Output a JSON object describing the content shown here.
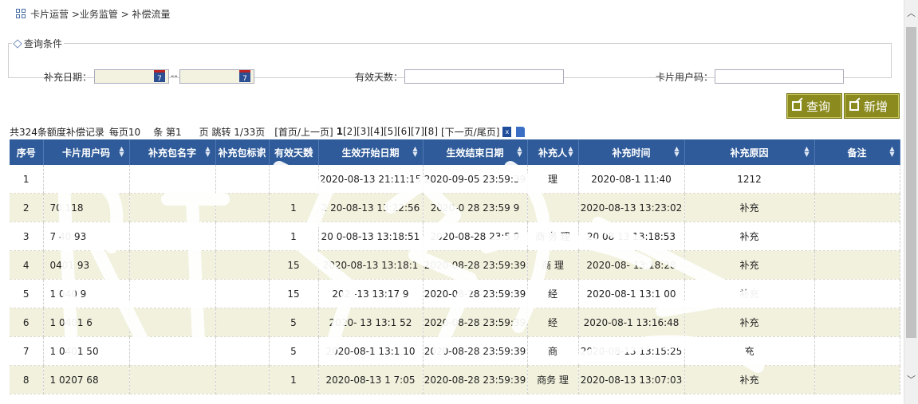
{
  "breadcrumb": {
    "text": "卡片运营 >业务监管 > 补偿流量"
  },
  "query": {
    "legend": "查询条件",
    "date_label": "补充日期：",
    "date_separator": "--",
    "cal_day": "7",
    "valid_days_label": "有效天数：",
    "card_user_label": "卡片用户码：",
    "date_from_value": "",
    "date_to_value": "",
    "valid_days_value": "",
    "card_user_value": ""
  },
  "buttons": {
    "query_label": "查询",
    "add_label": "新增"
  },
  "pager": {
    "summary": "共324条额度补偿记录",
    "per_page": "每页10",
    "tiao": "条 第1",
    "jump": "页 跳转 1/33页",
    "first_prev": "[首页/上一页]",
    "pages": [
      "1",
      "[2]",
      "[3]",
      "[4]",
      "[5]",
      "[6]",
      "[7]",
      "[8]"
    ],
    "next_last": "[下一页/尾页]",
    "excel_text": "x"
  },
  "table": {
    "headers": [
      "序号",
      "卡片用户码",
      "补充包名字",
      "补充包标识",
      "有效天数",
      "生效开始日期",
      "生效结束日期",
      "补充人",
      "补充时间",
      "补充原因",
      "备注"
    ],
    "rows": [
      [
        "1",
        "",
        "",
        "",
        "",
        "2020-08-13 21:11:15",
        "2020-09-05 23:59:39",
        "理",
        "2020-08-1 11:40",
        "1212",
        ""
      ],
      [
        "2",
        "70 118",
        "",
        "",
        "1",
        "2 20-08-13 13:22:56",
        "2020-0 28 23:59 9",
        "",
        "2020-08-13 13:23:02",
        "补充",
        ""
      ],
      [
        "3",
        "7 40 93",
        "",
        "",
        "1",
        "20 0-08-13 13:18:51",
        "2020-08-28 23:5 9",
        "商 务 理",
        "20 08 13 13:18:53",
        "补充",
        ""
      ],
      [
        "4",
        "0401 93",
        "",
        "",
        "15",
        "2020-08-13 13:18:1",
        "2020-08-28 23:59:39",
        "商 理",
        "2020-08- 13:18:28",
        "补充",
        ""
      ],
      [
        "5",
        "1 040 9",
        "",
        "",
        "15",
        "202 -13 13:17 9",
        "2020-08-28 23:59:39",
        "经",
        "2020-08-1 13:1 00",
        "补充",
        ""
      ],
      [
        "6",
        "1 0401 6",
        "",
        "",
        "5",
        "2020- 13 13:1 52",
        "2020-08-28 23:59:39",
        "经",
        "2020-08-1 13:16:48",
        "补充",
        ""
      ],
      [
        "7",
        "1 0401 50",
        "",
        "",
        "5",
        "2020-08-1 13:1 10",
        "2020-08-28 23:59:39",
        "商",
        "2020-08-13 13:15:25",
        "充",
        ""
      ],
      [
        "8",
        "1 0207 68",
        "",
        "",
        "1",
        "2020-08-13 1 7:05",
        "2020-08-28 23:59:39",
        "商务 理",
        "2020-08-13 13:07:03",
        "补充",
        ""
      ]
    ]
  },
  "colors": {
    "header_bg": "#2f5b9a",
    "row_alt": "#f2f1dd",
    "button_bg": "#8a8a1e",
    "date_bg": "#f3f1df"
  }
}
